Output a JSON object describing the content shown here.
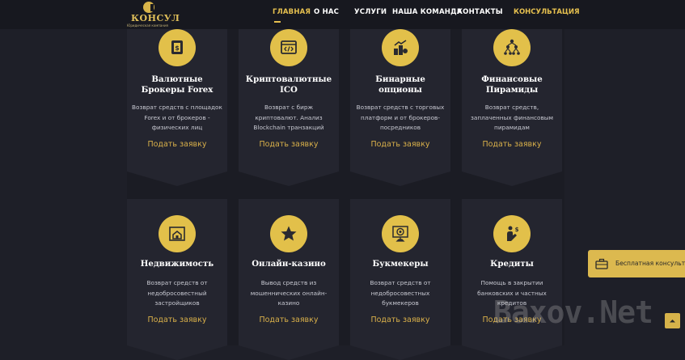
{
  "logo": {
    "name": "КОНСУЛ",
    "subtitle": "Юридическая компания"
  },
  "nav": {
    "items": [
      "ГЛАВНАЯ",
      "О НАС",
      "УСЛУГИ",
      "НАША КОМАНДА",
      "КОНТАКТЫ"
    ],
    "cta": "КОНСУЛЬТАЦИЯ"
  },
  "cards": [
    {
      "icon": "cash-hand-icon",
      "title": [
        "Валютные",
        "Брокеры Forex"
      ],
      "desc": [
        "Возврат средств с площадок",
        "Forex и от брокеров -",
        "физических лиц"
      ],
      "link": "Подать заявку"
    },
    {
      "icon": "code-window-icon",
      "title": [
        "Криптовалютные",
        "ICO"
      ],
      "desc": [
        "Возврат с бирж",
        "криптовалют. Анализ",
        "Blockchain транзакций"
      ],
      "link": "Подать заявку"
    },
    {
      "icon": "coins-chart-icon",
      "title": [
        "Бинарные",
        "опционы"
      ],
      "desc": [
        "Возврат средств с торговых",
        "платформ и от брокеров-",
        "посредников"
      ],
      "link": "Подать заявку"
    },
    {
      "icon": "pyramid-network-icon",
      "title": [
        "Финансовые",
        "Пирамиды"
      ],
      "desc": [
        "Возврат средств,",
        "заплаченных финансовым",
        "пирамидам"
      ],
      "link": "Подать заявку"
    },
    {
      "icon": "house-blueprint-icon",
      "title": [
        "Недвижимость"
      ],
      "desc": [
        "Возврат средств от",
        "недобросовестный",
        "застройщиков"
      ],
      "link": "Подать заявку"
    },
    {
      "icon": "star-icon",
      "title": [
        "Онлайн-казино"
      ],
      "desc": [
        "Вывод средств из",
        "мошеннических онлайн-",
        "казино"
      ],
      "link": "Подать заявку"
    },
    {
      "icon": "target-trophy-icon",
      "title": [
        "Букмекеры"
      ],
      "desc": [
        "Возврат средств от",
        "недобросовестных",
        "букмекеров"
      ],
      "link": "Подать заявку"
    },
    {
      "icon": "hand-money-icon",
      "title": [
        "Кредиты"
      ],
      "desc": [
        "Помощь в закрытии",
        "банковских и частных",
        "кредитов"
      ],
      "link": "Подать заявку"
    }
  ],
  "widget": {
    "label": "Бесплатная консультация"
  },
  "watermark": "Baxov.Net",
  "colors": {
    "accent": "#e2c04a",
    "background": "#1e1f28",
    "card": "#24252f"
  }
}
